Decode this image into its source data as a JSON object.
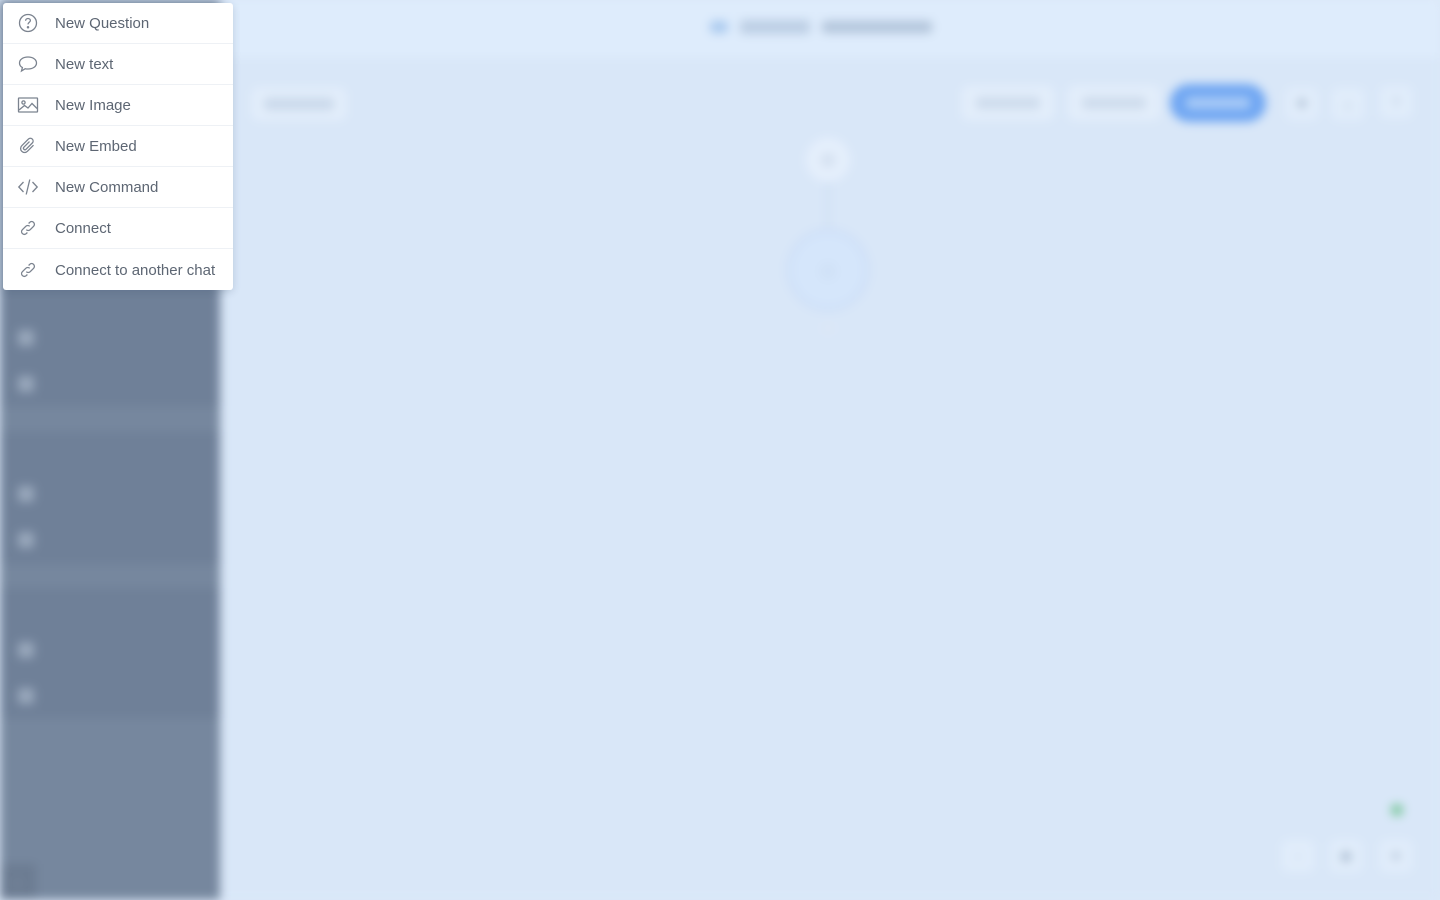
{
  "menu": {
    "items": [
      {
        "label": "New Question",
        "icon": "question-circle-icon"
      },
      {
        "label": "New text",
        "icon": "speech-bubble-icon"
      },
      {
        "label": "New Image",
        "icon": "image-icon"
      },
      {
        "label": "New Embed",
        "icon": "paperclip-icon"
      },
      {
        "label": "New Command",
        "icon": "code-icon"
      },
      {
        "label": "Connect",
        "icon": "link-icon"
      },
      {
        "label": "Connect to another chat",
        "icon": "link-icon"
      }
    ]
  },
  "colors": {
    "menu_text": "#5d6673",
    "sidebar": "#76879e",
    "canvas": "#d9e7f8",
    "publish": "#6fa6f2",
    "status": "#79c79a"
  }
}
